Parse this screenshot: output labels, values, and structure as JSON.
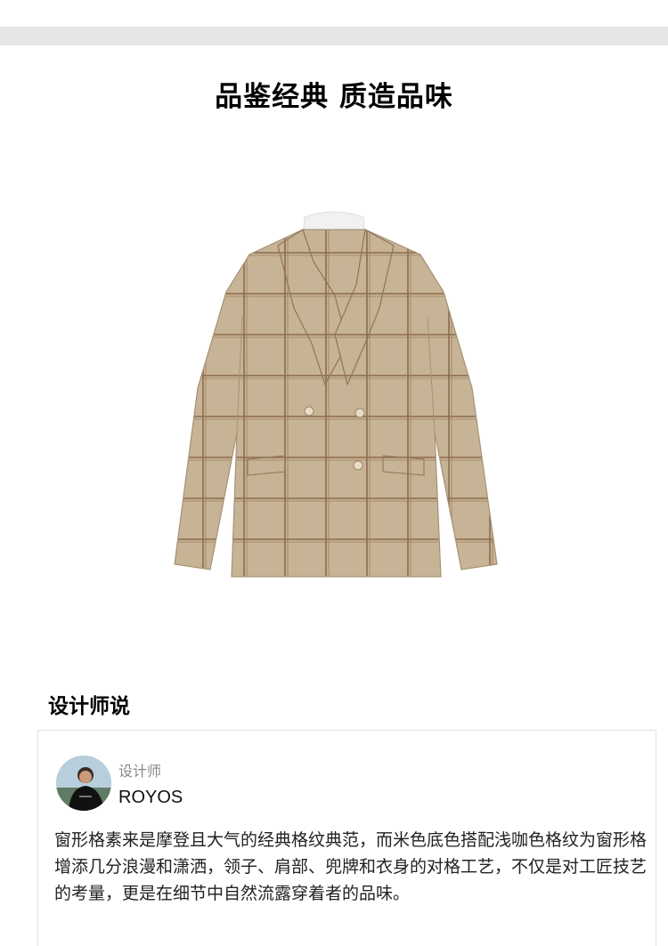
{
  "headline": "品鉴经典  质造品味",
  "product": {
    "image_icon": "double-breasted-plaid-suit-jacket"
  },
  "section_title": "设计师说",
  "designer": {
    "role": "设计师",
    "name": "ROYOS",
    "avatar_icon": "designer-avatar-photo",
    "description": "窗形格素来是摩登且大气的经典格纹典范，而米色底色搭配浅咖色格纹为窗形格增添几分浪漫和潇洒，领子、肩部、兜牌和衣身的对格工艺，不仅是对工匠技艺的考量，更是在细节中自然流露穿着者的品味。"
  },
  "colors": {
    "top_band": "#e6e6e6",
    "jacket": "#c9b596",
    "plaid": "#8a6a4a",
    "tie": "#1f2f5a"
  }
}
